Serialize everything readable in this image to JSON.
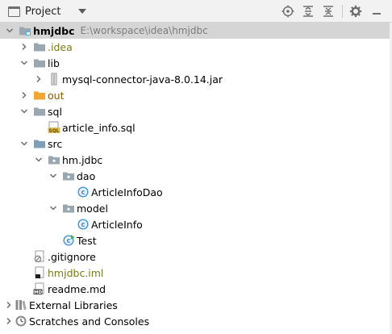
{
  "panel": {
    "title": "Project",
    "toolbar": {
      "icons": [
        "locate-icon",
        "expand-all-icon",
        "collapse-all-icon",
        "gear-icon",
        "hide-icon"
      ]
    }
  },
  "tree": [
    {
      "label": "hmjdbc",
      "path": "E:\\workspace\\idea\\hmjdbc",
      "icon": "module-folder-icon",
      "expanded": true,
      "selected": true
    },
    {
      "label": ".idea",
      "icon": "folder-icon",
      "expanded": false
    },
    {
      "label": "lib",
      "icon": "folder-icon",
      "expanded": true
    },
    {
      "label": "mysql-connector-java-8.0.14.jar",
      "icon": "jar-icon",
      "expanded": false
    },
    {
      "label": "out",
      "icon": "excluded-folder-icon",
      "expanded": false
    },
    {
      "label": "sql",
      "icon": "folder-icon",
      "expanded": true
    },
    {
      "label": "article_info.sql",
      "icon": "sql-file-icon"
    },
    {
      "label": "src",
      "icon": "source-folder-icon",
      "expanded": true
    },
    {
      "label": "hm.jdbc",
      "icon": "package-icon",
      "expanded": true
    },
    {
      "label": "dao",
      "icon": "package-icon",
      "expanded": true
    },
    {
      "label": "ArticleInfoDao",
      "icon": "java-class-icon"
    },
    {
      "label": "model",
      "icon": "package-icon",
      "expanded": true
    },
    {
      "label": "ArticleInfo",
      "icon": "java-class-icon"
    },
    {
      "label": "Test",
      "icon": "java-main-class-icon"
    },
    {
      "label": ".gitignore",
      "icon": "gitignore-file-icon"
    },
    {
      "label": "hmjdbc.iml",
      "icon": "iml-file-icon"
    },
    {
      "label": "readme.md",
      "icon": "markdown-file-icon"
    },
    {
      "label": "External Libraries",
      "icon": "libraries-icon",
      "expanded": false
    },
    {
      "label": "Scratches and Consoles",
      "icon": "scratches-icon",
      "expanded": false
    }
  ],
  "colors": {
    "folder": "#9aa7b0",
    "excluded_folder": "#f0a732",
    "source_folder": "#7f9fb8",
    "java_class": "#3c8fd6",
    "main_class_accent": "#59a869",
    "olive_text": "#7a7a1a",
    "brown_text": "#8a5a00",
    "path_text": "#7d7d7d",
    "selection": "#d5d5d5"
  }
}
